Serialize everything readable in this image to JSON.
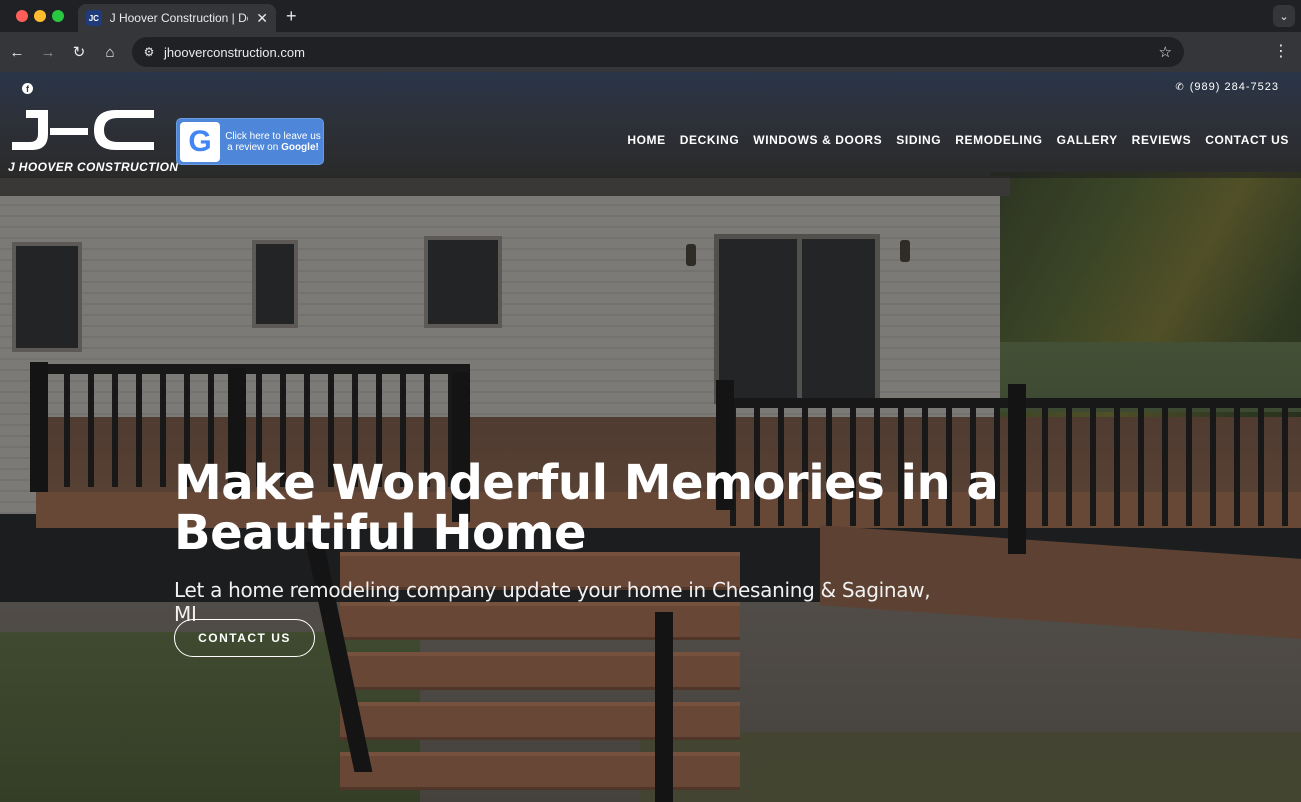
{
  "browser": {
    "tab_title": "J Hoover Construction | Deck",
    "tab_close_icon": "close-icon",
    "new_tab_icon": "plus-icon",
    "url": "jhooverconstruction.com"
  },
  "site": {
    "phone": "(989) 284-7523",
    "social": [
      "facebook-icon"
    ],
    "logo_text": "J HOOVER CONSTRUCTION",
    "google_badge": {
      "line1": "Click here to leave us",
      "line2_prefix": "a review on ",
      "line2_bold": "Google!"
    },
    "nav": [
      "HOME",
      "DECKING",
      "WINDOWS & DOORS",
      "SIDING",
      "REMODELING",
      "GALLERY",
      "REVIEWS",
      "CONTACT US"
    ]
  },
  "hero": {
    "title": "Make Wonderful Memories in a Beautiful Home",
    "subtitle": "Let a home remodeling company update your home in Chesaning & Saginaw, MI",
    "cta_label": "CONTACT US"
  },
  "colors": {
    "google_badge_bg": "#4e86d9",
    "header_overlay": "rgba(30,30,30,0.55)"
  }
}
